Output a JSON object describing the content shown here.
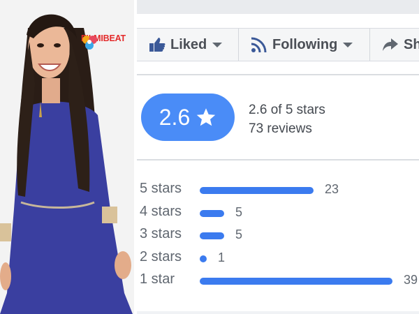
{
  "photo": {
    "logo_text": "FILMIBEAT"
  },
  "action_bar": {
    "liked_label": "Liked",
    "following_label": "Following",
    "share_label": "Share"
  },
  "rating": {
    "average": "2.6",
    "summary": "2.6 of 5 stars",
    "reviews": "73 reviews",
    "accent_color": "#4a8cf7"
  },
  "breakdown": {
    "bar_color": "#3b7bef",
    "max_count": 39,
    "rows": [
      {
        "label": "5 stars",
        "count": 23
      },
      {
        "label": "4 stars",
        "count": 5
      },
      {
        "label": "3 stars",
        "count": 5
      },
      {
        "label": "2 stars",
        "count": 1
      },
      {
        "label": "1 star",
        "count": 39
      }
    ]
  }
}
